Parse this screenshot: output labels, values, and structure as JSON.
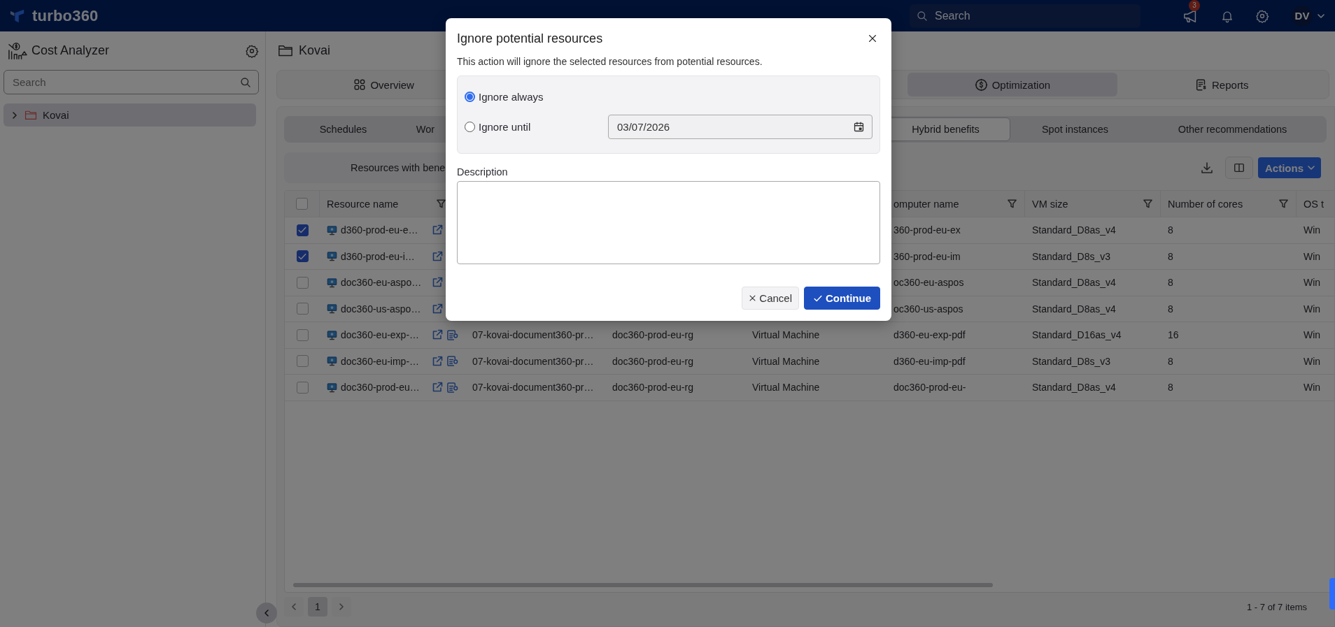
{
  "app": {
    "logo_text": "turbo360",
    "search": {
      "placeholder": "Search"
    },
    "announcements_badge": "3",
    "user_initials": "DV"
  },
  "sidebar": {
    "title": "Cost Analyzer",
    "search": {
      "placeholder": "Search"
    },
    "tree": [
      {
        "label": "Kovai",
        "expanded": false,
        "selected": true
      }
    ]
  },
  "main": {
    "title": "Kovai",
    "tabs": [
      {
        "label": "Overview",
        "selected": false
      },
      {
        "label": "Optimization",
        "selected": true
      },
      {
        "label": "Reports",
        "selected": false
      }
    ],
    "subtabs": [
      {
        "label": "Schedules",
        "selected": false
      },
      {
        "label": "Wor",
        "selected": false
      },
      {
        "label": "Hybrid benefits",
        "selected": true
      },
      {
        "label": "Spot instances",
        "selected": false
      },
      {
        "label": "Other recommendations",
        "selected": false
      }
    ],
    "view_toggle": {
      "label": "Resources with bene"
    },
    "actions_button": "Actions",
    "table": {
      "all_checked": false,
      "columns": {
        "resource_name": {
          "label": "Resource name",
          "filter": true
        },
        "computer_name": {
          "label": "omputer name",
          "filter": true
        },
        "vm_size": {
          "label": "VM size",
          "filter": true
        },
        "number_of_cores": {
          "label": "Number of cores",
          "filter": true
        },
        "column_9": {
          "label": "OS t"
        }
      },
      "rows": [
        {
          "checked": true,
          "resource_name": "d360-prod-eu-e…",
          "computer_name": "360-prod-eu-ex",
          "vm_size": "Standard_D8as_v4",
          "number_of_cores": "8",
          "column_9": "Win"
        },
        {
          "checked": true,
          "resource_name": "d360-prod-eu-i…",
          "computer_name": "360-prod-eu-im",
          "vm_size": "Standard_D8s_v3",
          "number_of_cores": "8",
          "column_9": "Win"
        },
        {
          "checked": false,
          "resource_name": "doc360-eu-aspo…",
          "computer_name": "oc360-eu-aspos",
          "vm_size": "Standard_D8as_v4",
          "number_of_cores": "8",
          "column_9": "Win"
        },
        {
          "checked": false,
          "resource_name": "doc360-us-aspo…",
          "computer_name": "oc360-us-aspos",
          "vm_size": "Standard_D8as_v4",
          "number_of_cores": "8",
          "column_9": "Win"
        },
        {
          "checked": false,
          "resource_name": "doc360-eu-exp-…",
          "column_3": "07-kovai-document360-pr…",
          "column_4": "doc360-prod-eu-rg",
          "column_5": "Virtual Machine",
          "computer_name": "d360-eu-exp-pdf",
          "vm_size": "Standard_D16as_v4",
          "number_of_cores": "16",
          "column_9": "Win"
        },
        {
          "checked": false,
          "resource_name": "doc360-eu-imp-…",
          "column_3": "07-kovai-document360-pr…",
          "column_4": "doc360-prod-eu-rg",
          "column_5": "Virtual Machine",
          "computer_name": "d360-eu-imp-pdf",
          "vm_size": "Standard_D8s_v3",
          "number_of_cores": "8",
          "column_9": "Win"
        },
        {
          "checked": false,
          "resource_name": "doc360-prod-eu…",
          "column_3": "07-kovai-document360-pr…",
          "column_4": "doc360-prod-eu-rg",
          "column_5": "Virtual Machine",
          "computer_name": "doc360-prod-eu-",
          "vm_size": "Standard_D8as_v4",
          "number_of_cores": "8",
          "column_9": "Win"
        }
      ]
    },
    "pagination": {
      "pages": [
        {
          "label": "1",
          "selected": true
        }
      ],
      "summary": "1 - 7 of 7 items"
    }
  },
  "dialog": {
    "title": "Ignore potential resources",
    "message": "This action will ignore the selected resources from potential resources.",
    "options": [
      {
        "label": "Ignore always",
        "selected": true
      },
      {
        "label": "Ignore until",
        "selected": false
      }
    ],
    "date": {
      "value": "03/07/2026"
    },
    "description": {
      "label": "Description"
    },
    "buttons": [
      {
        "kind": "secondary",
        "label": "Cancel"
      },
      {
        "kind": "primary",
        "label": "Continue"
      }
    ]
  }
}
